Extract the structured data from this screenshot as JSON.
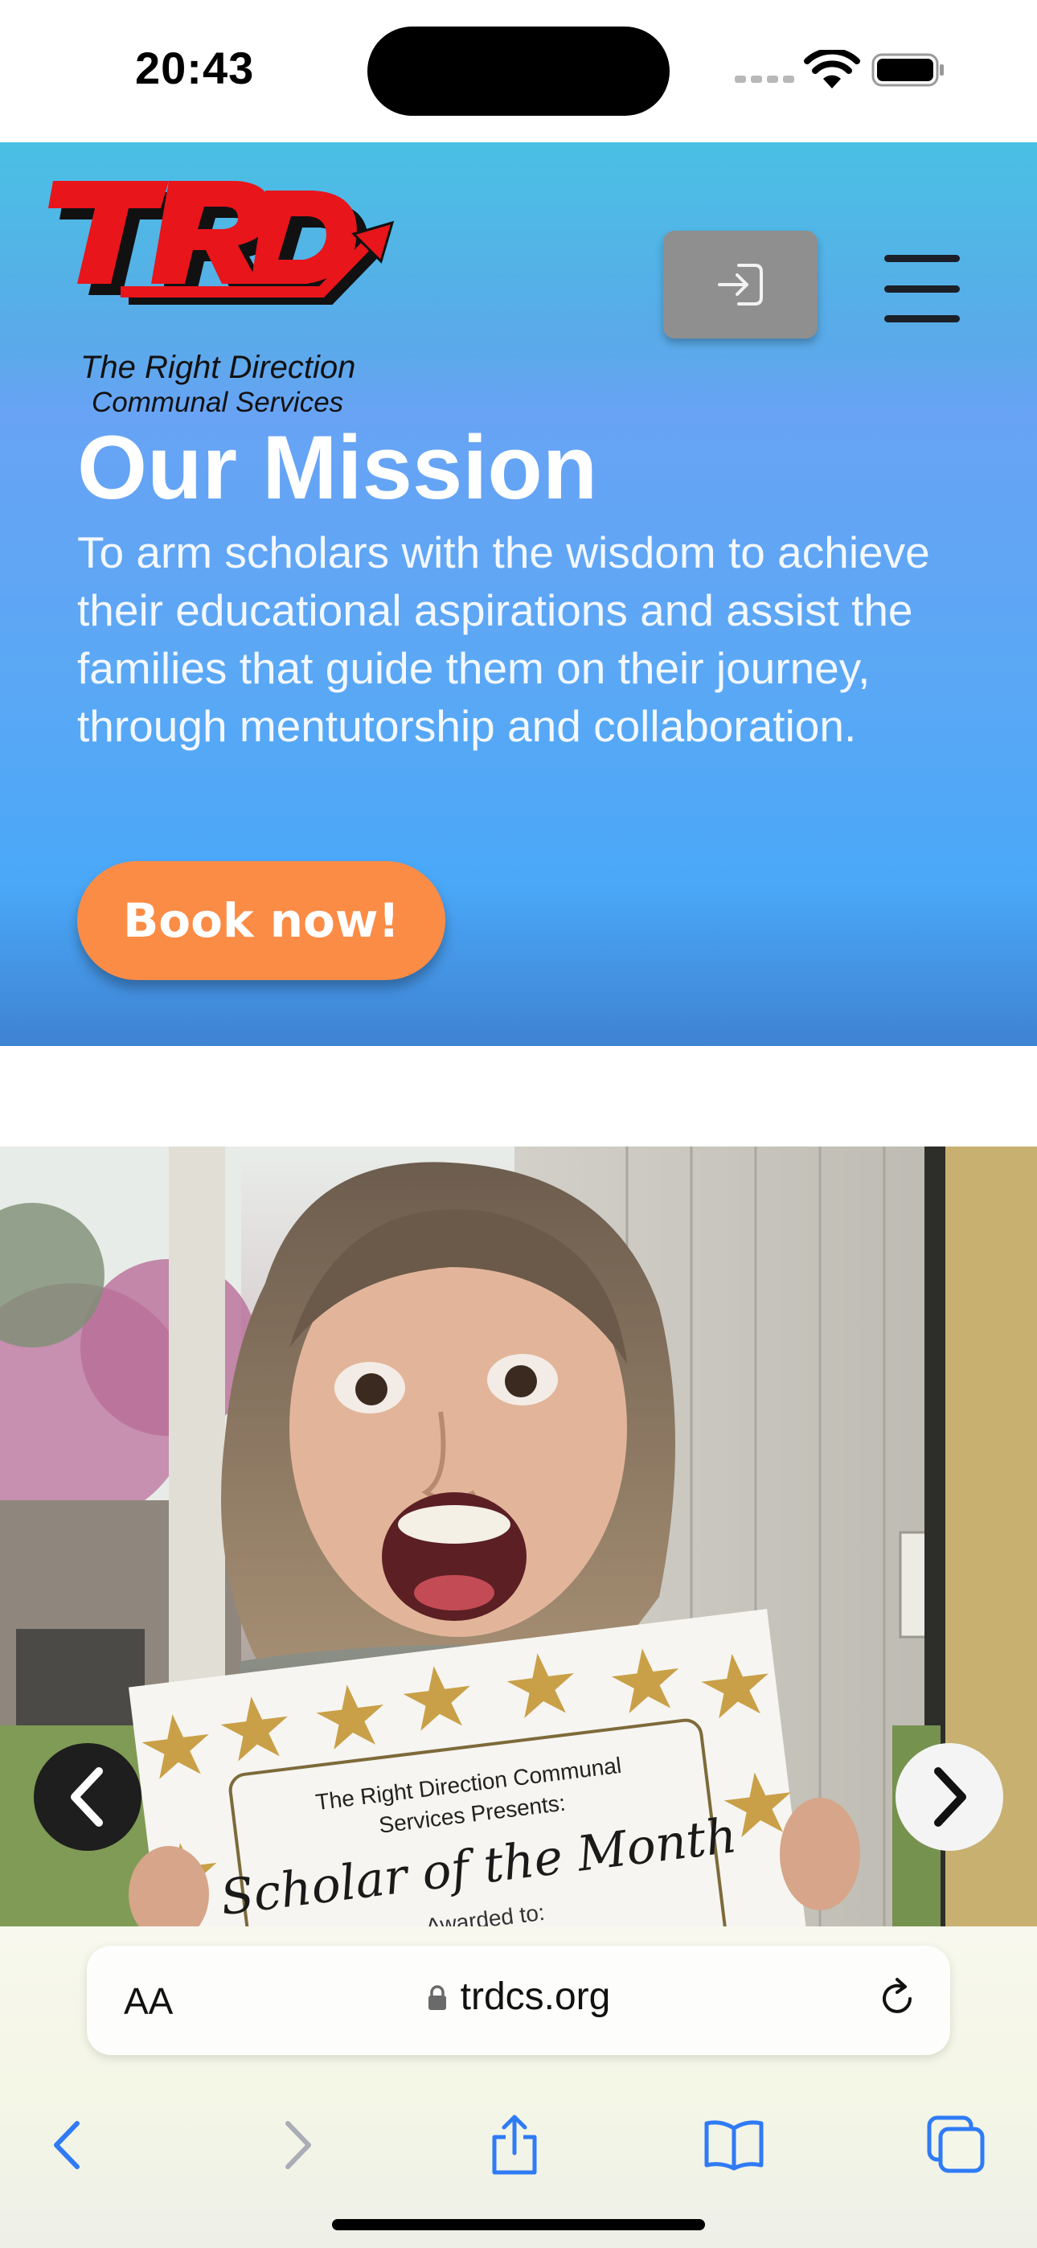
{
  "status_bar": {
    "time": "20:43"
  },
  "header": {
    "logo_text": "TRD",
    "logo_line1": "The Right Direction",
    "logo_line2": "Communal Services",
    "login_icon": "login-icon",
    "menu_icon": "hamburger-menu-icon"
  },
  "hero": {
    "title": "Our Mission",
    "text": "To arm scholars with the wisdom to achieve their educational aspirations and assist the families that guide them on their journey, through mentutorship and collaboration.",
    "cta_label": "Book now!"
  },
  "carousel": {
    "certificate_line1": "The Right Direction Communal",
    "certificate_line2": "Services Presents:",
    "certificate_title": "Scholar of the Month",
    "certificate_awarded": "Awarded to:",
    "prev_icon": "chevron-left-icon",
    "next_icon": "chevron-right-icon"
  },
  "browser": {
    "aa_label": "AA",
    "url": "trdcs.org",
    "toolbar_icons": [
      "back-icon",
      "forward-icon",
      "share-icon",
      "bookmarks-icon",
      "tabs-icon"
    ]
  },
  "colors": {
    "cta": "#fb8c46",
    "logo_red": "#e8151b",
    "hero_top": "#49c0e4",
    "hero_bottom": "#3f82d2"
  }
}
